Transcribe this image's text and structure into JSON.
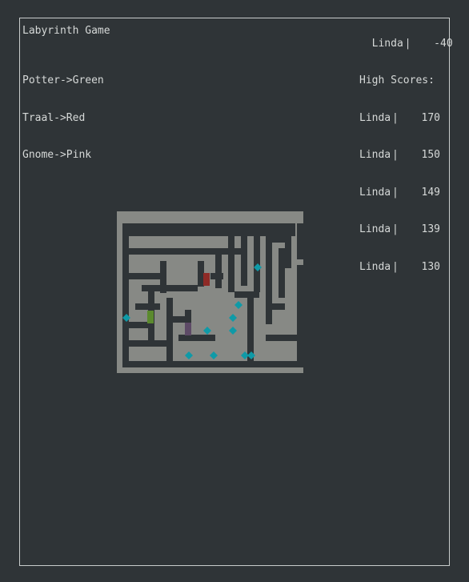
{
  "title": "Labyrinth Game",
  "player": {
    "name": "Linda",
    "separator": "|",
    "score": "-40"
  },
  "legend": [
    {
      "text": "Potter->Green",
      "color": "#5b8a2e"
    },
    {
      "text": "Traal->Red",
      "color": "#8e2a26"
    },
    {
      "text": "Gnome->Pink",
      "color": "#5d4a66"
    }
  ],
  "high_scores": {
    "heading": "High Scores:",
    "entries": [
      {
        "name": "Linda",
        "separator": "|",
        "score": "170"
      },
      {
        "name": "Linda",
        "separator": "|",
        "score": "150"
      },
      {
        "name": "Linda",
        "separator": "|",
        "score": "149"
      },
      {
        "name": "Linda",
        "separator": "|",
        "score": "139"
      },
      {
        "name": "Linda",
        "separator": "|",
        "score": "130"
      }
    ]
  },
  "colors": {
    "background": "#2f3437",
    "wall": "#878985",
    "floor": "#2f3437",
    "gem": "#0f9aa7"
  }
}
